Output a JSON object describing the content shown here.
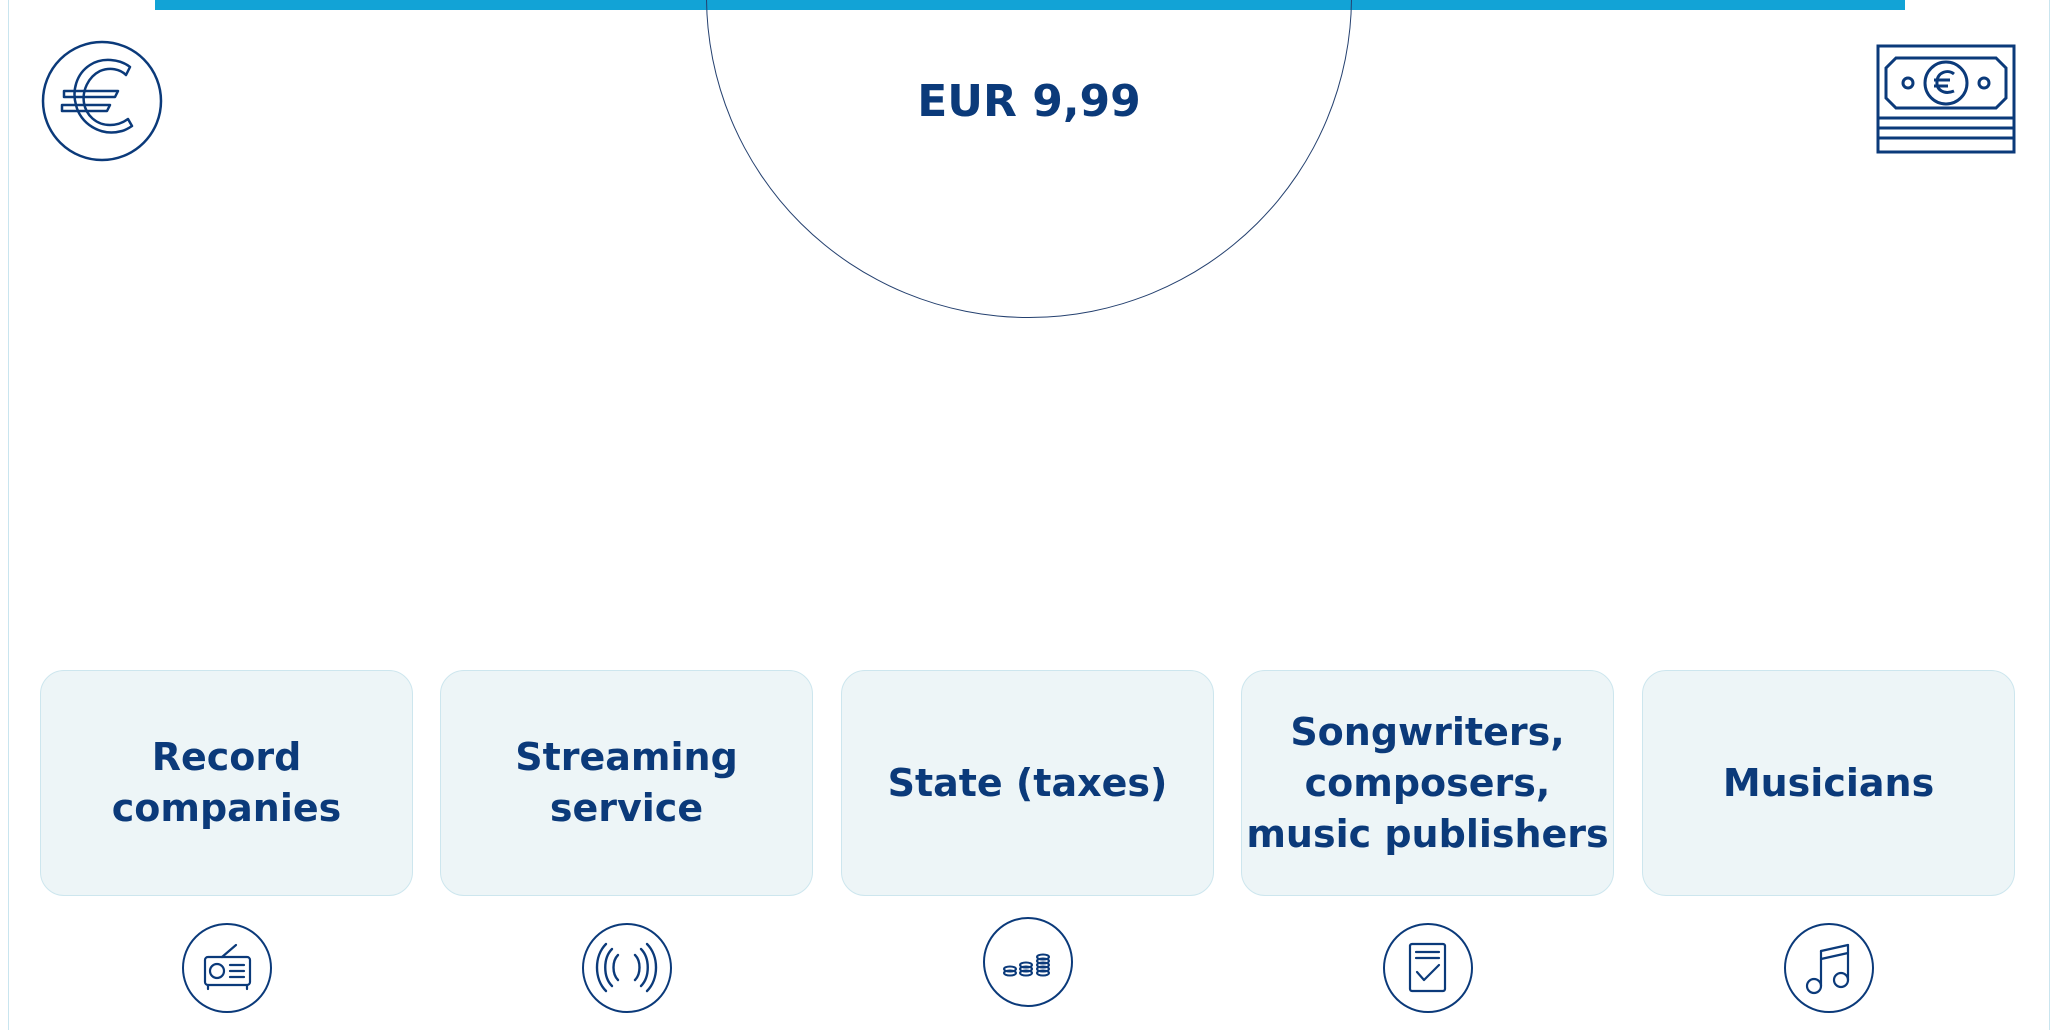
{
  "price": {
    "label": "EUR 9,99"
  },
  "icons": {
    "top_left": "euro-icon",
    "top_right": "banknote-icon"
  },
  "recipients": [
    {
      "label": "Record\ncompanies",
      "icon": "radio-icon"
    },
    {
      "label": "Streaming\nservice",
      "icon": "broadcast-icon"
    },
    {
      "label": "State (taxes)",
      "icon": "coins-icon"
    },
    {
      "label": "Songwriters,\ncomposers,\nmusic publishers",
      "icon": "document-check-icon"
    },
    {
      "label": "Musicians",
      "icon": "music-note-icon"
    }
  ],
  "colors": {
    "primary": "#0b3a7a",
    "accent": "#12a3d6",
    "card_background": "#edf5f7",
    "card_border": "#cde6ee"
  }
}
